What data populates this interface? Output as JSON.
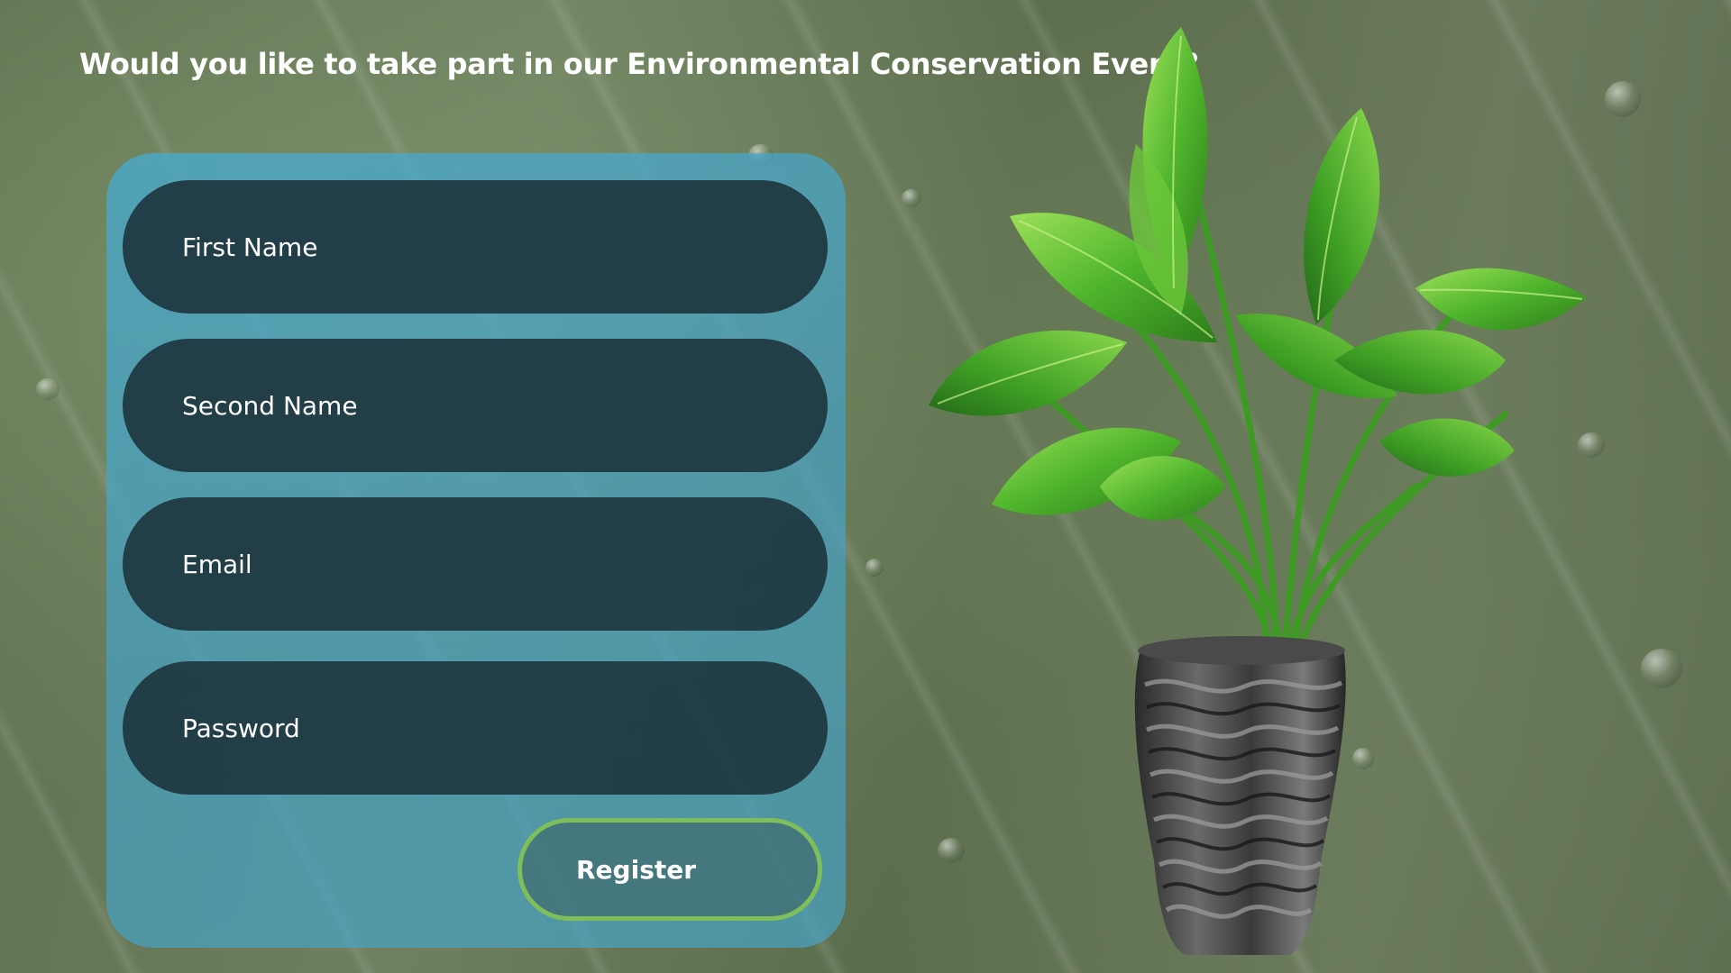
{
  "page": {
    "headline": "Would you like to take part in our Environmental Conservation Event?"
  },
  "form": {
    "fields": [
      {
        "placeholder": "First Name",
        "type": "text"
      },
      {
        "placeholder": "Second Name",
        "type": "text"
      },
      {
        "placeholder": "Email",
        "type": "email"
      },
      {
        "placeholder": "Password",
        "type": "password"
      }
    ],
    "register_label": "Register"
  },
  "illustration": {
    "icon": "potted-plant-icon"
  },
  "colors": {
    "panel": "#48AACD",
    "field": "#1E373F",
    "button_border": "#7FBF5A",
    "text": "#FFFFFF"
  }
}
